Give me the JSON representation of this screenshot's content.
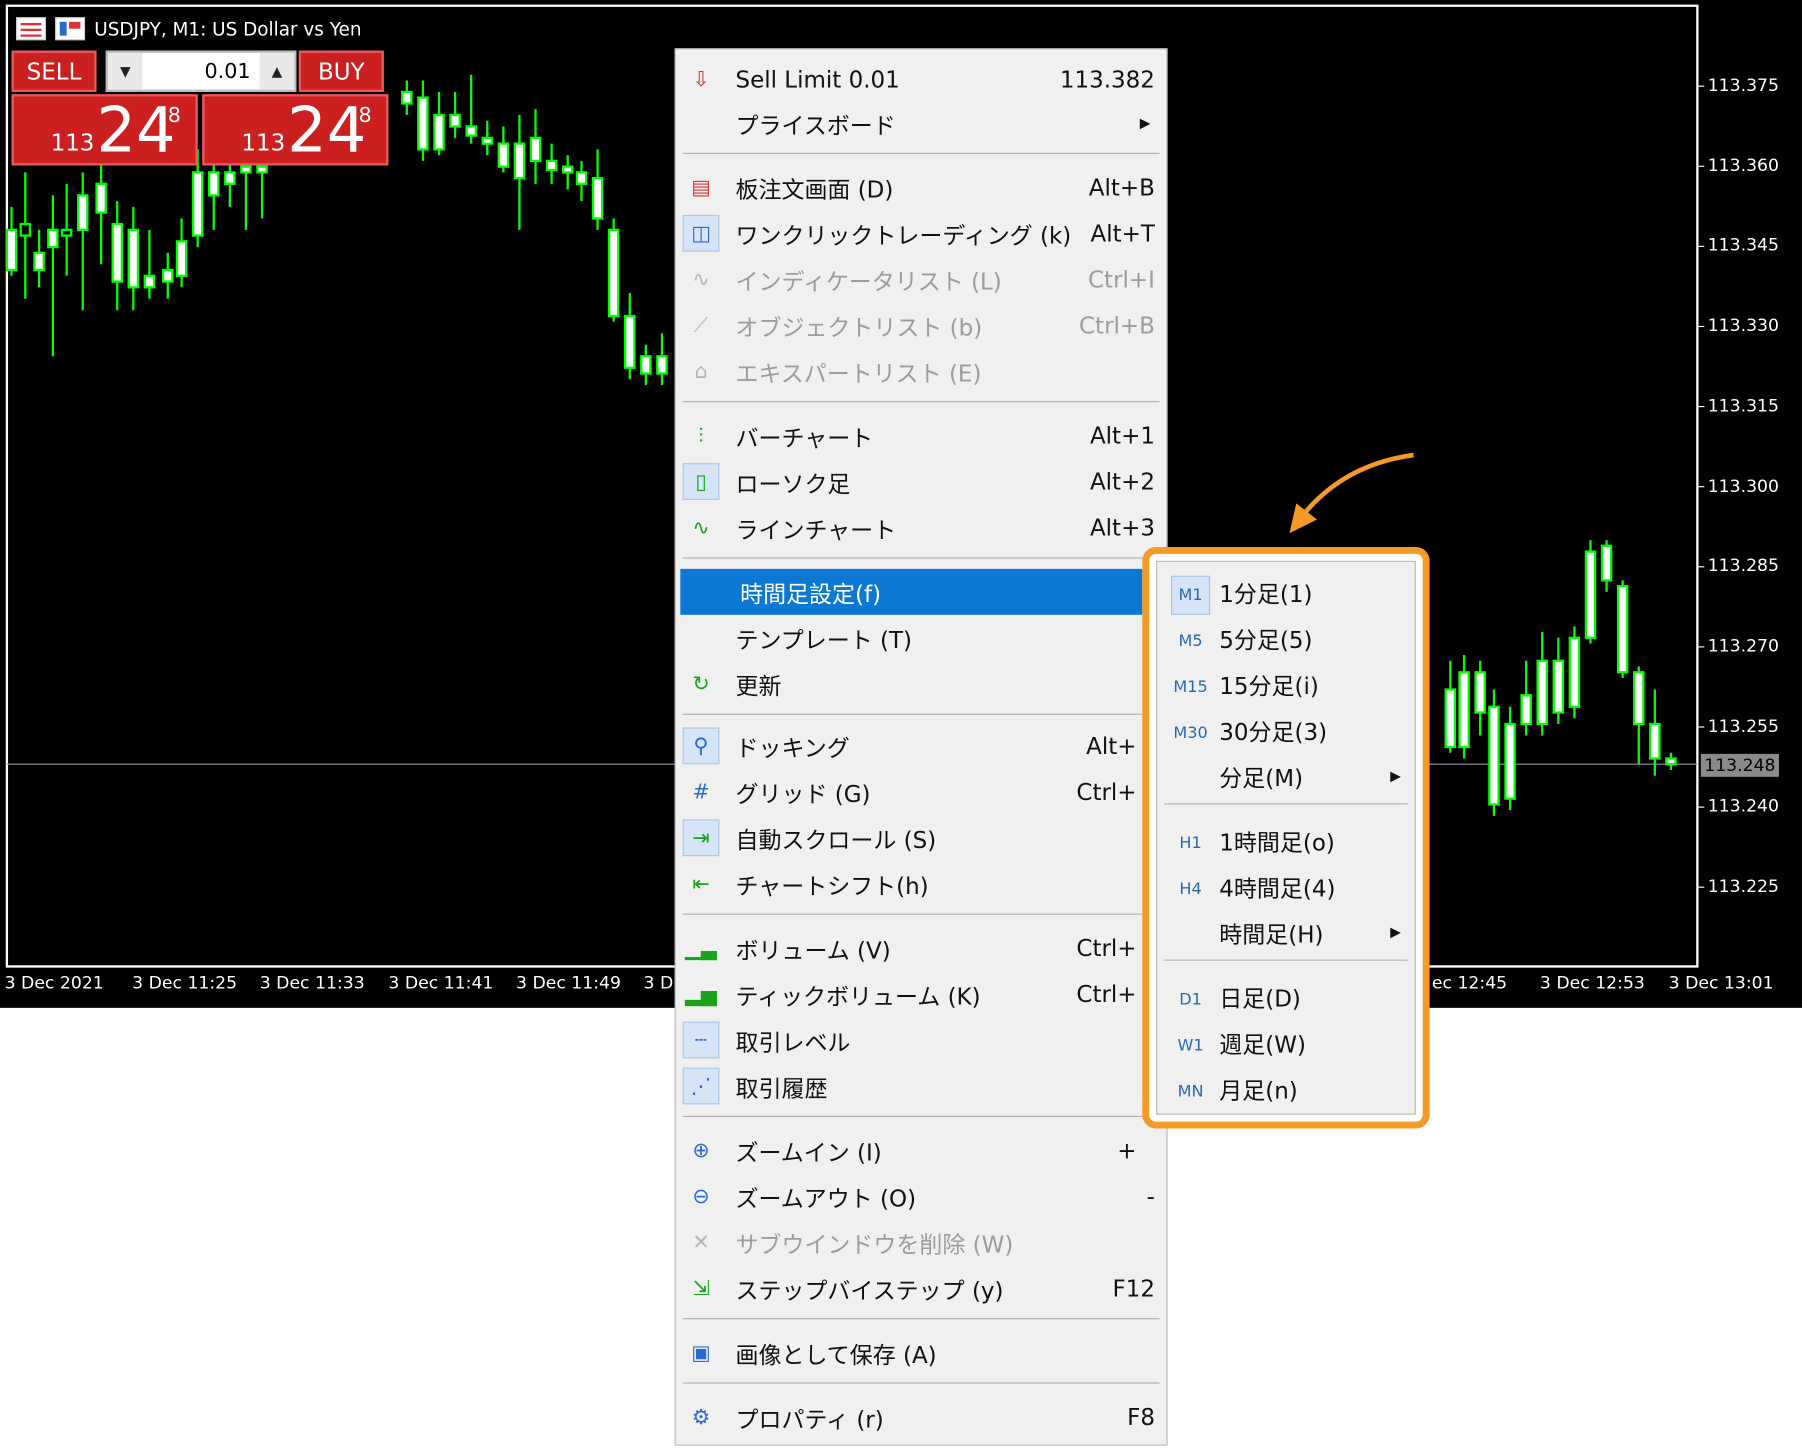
{
  "window_title": "USDJPY, M1:  US Dollar vs Yen",
  "trading_panel": {
    "sell_label": "SELL",
    "buy_label": "BUY",
    "lot_value": "0.01",
    "sell_price": {
      "prefix": "113",
      "big": "24",
      "pip": "8"
    },
    "buy_price": {
      "prefix": "113",
      "big": "24",
      "pip": "8"
    }
  },
  "price_axis": [
    "113.375",
    "113.360",
    "113.345",
    "113.330",
    "113.315",
    "113.300",
    "113.285",
    "113.270",
    "113.255",
    "113.240",
    "113.225"
  ],
  "current_price": "113.248",
  "time_axis": [
    "3 Dec 2021",
    "3 Dec 11:25",
    "3 Dec 11:33",
    "3 Dec 11:41",
    "3 Dec 11:49",
    "3 D",
    "ec 12:45",
    "3 Dec 12:53",
    "3 Dec 13:01"
  ],
  "context_menu": {
    "items": [
      {
        "label": "Sell Limit 0.01",
        "shortcut": "113.382",
        "icon": "sell-limit-icon"
      },
      {
        "label": "プライスボード",
        "shortcut": "",
        "icon": "",
        "submenu": true
      },
      {
        "label": "板注文画面 (D)",
        "shortcut": "Alt+B",
        "icon": "depth-of-market-icon"
      },
      {
        "label": "ワンクリックトレーディング (k)",
        "shortcut": "Alt+T",
        "icon": "one-click-trading-icon",
        "checked": true
      },
      {
        "label": "インディケータリスト (L)",
        "shortcut": "Ctrl+I",
        "icon": "indicator-list-icon",
        "disabled": true
      },
      {
        "label": "オブジェクトリスト (b)",
        "shortcut": "Ctrl+B",
        "icon": "object-list-icon",
        "disabled": true
      },
      {
        "label": "エキスパートリスト (E)",
        "shortcut": "",
        "icon": "expert-list-icon",
        "disabled": true
      },
      {
        "label": "バーチャート",
        "shortcut": "Alt+1",
        "icon": "bar-chart-icon"
      },
      {
        "label": "ローソク足",
        "shortcut": "Alt+2",
        "icon": "candlestick-icon",
        "checked": true
      },
      {
        "label": "ラインチャート",
        "shortcut": "Alt+3",
        "icon": "line-chart-icon"
      },
      {
        "label": "時間足設定(f)",
        "shortcut": "",
        "icon": "",
        "highlighted": true
      },
      {
        "label": "テンプレート (T)",
        "shortcut": "",
        "icon": ""
      },
      {
        "label": "更新",
        "shortcut": "",
        "icon": "refresh-icon"
      },
      {
        "label": "ドッキング",
        "shortcut": "Alt+",
        "icon": "pin-icon",
        "checked": true
      },
      {
        "label": "グリッド (G)",
        "shortcut": "Ctrl+",
        "icon": "grid-icon"
      },
      {
        "label": "自動スクロール (S)",
        "shortcut": "",
        "icon": "auto-scroll-icon",
        "checked": true
      },
      {
        "label": "チャートシフト(h)",
        "shortcut": "",
        "icon": "chart-shift-icon"
      },
      {
        "label": "ボリューム (V)",
        "shortcut": "Ctrl+",
        "icon": "volume-icon"
      },
      {
        "label": "ティックボリューム (K)",
        "shortcut": "Ctrl+",
        "icon": "tick-volume-icon"
      },
      {
        "label": "取引レベル",
        "shortcut": "",
        "icon": "trade-levels-icon",
        "checked": true
      },
      {
        "label": "取引履歴",
        "shortcut": "",
        "icon": "trade-history-icon",
        "checked": true
      },
      {
        "label": "ズームイン (I)",
        "shortcut": "+",
        "icon": "zoom-in-icon"
      },
      {
        "label": "ズームアウト (O)",
        "shortcut": "-",
        "icon": "zoom-out-icon"
      },
      {
        "label": "サブウインドウを削除 (W)",
        "shortcut": "",
        "icon": "close-icon",
        "disabled": true
      },
      {
        "label": "ステップバイステップ (y)",
        "shortcut": "F12",
        "icon": "step-icon"
      },
      {
        "label": "画像として保存 (A)",
        "shortcut": "",
        "icon": "save-image-icon"
      },
      {
        "label": "プロパティ (r)",
        "shortcut": "F8",
        "icon": "gear-icon"
      }
    ]
  },
  "timeframe_menu": {
    "items": [
      {
        "code": "M1",
        "label": "1分足(1)",
        "checked": true
      },
      {
        "code": "M5",
        "label": "5分足(5)"
      },
      {
        "code": "M15",
        "label": "15分足(i)"
      },
      {
        "code": "M30",
        "label": "30分足(3)"
      },
      {
        "code": "",
        "label": "分足(M)",
        "submenu": true
      },
      {
        "code": "H1",
        "label": "1時間足(o)"
      },
      {
        "code": "H4",
        "label": "4時間足(4)"
      },
      {
        "code": "",
        "label": "時間足(H)",
        "submenu": true
      },
      {
        "code": "D1",
        "label": "日足(D)"
      },
      {
        "code": "W1",
        "label": "週足(W)"
      },
      {
        "code": "MN",
        "label": "月足(n)"
      }
    ]
  },
  "colors": {
    "highlight_border": "#f39a27",
    "menu_highlight": "#0b78d4",
    "candle": "#00ff00"
  }
}
